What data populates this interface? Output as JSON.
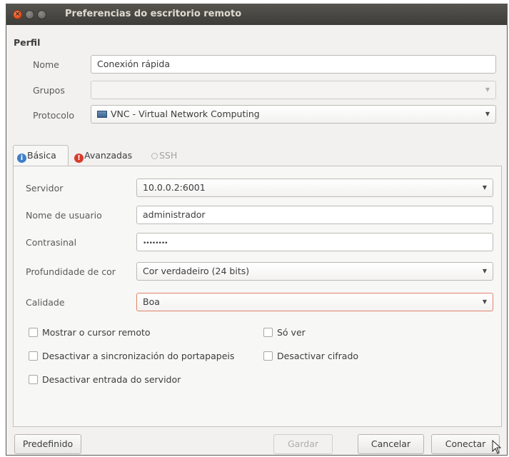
{
  "window": {
    "title": "Preferencias do escritorio remoto"
  },
  "profile": {
    "section_label": "Perfil",
    "name_label": "Nome",
    "name_value": "Conexión rápida",
    "groups_label": "Grupos",
    "groups_value": "",
    "protocol_label": "Protocolo",
    "protocol_value": "VNC - Virtual Network Computing"
  },
  "tabs": [
    {
      "label": "Básica",
      "icon": "info-icon",
      "active": true
    },
    {
      "label": "Avanzadas",
      "icon": "warning-icon",
      "active": false
    },
    {
      "label": "SSH",
      "icon": "ssh-icon",
      "active": false
    }
  ],
  "basic": {
    "server_label": "Servidor",
    "server_value": "10.0.0.2:6001",
    "user_label": "Nome de usuario",
    "user_value": "administrador",
    "password_label": "Contrasinal",
    "password_value": "••••••••",
    "color_depth_label": "Profundidade de cor",
    "color_depth_value": "Cor verdadeiro (24 bits)",
    "quality_label": "Calidade",
    "quality_value": "Boa"
  },
  "checkboxes": {
    "show_remote_cursor": {
      "label": "Mostrar o cursor remoto",
      "checked": false
    },
    "view_only": {
      "label": "Só ver",
      "checked": false
    },
    "disable_clipboard_sync": {
      "label": "Desactivar a sincronización do portapapeis",
      "checked": false
    },
    "disable_encryption": {
      "label": "Desactivar cifrado",
      "checked": false
    },
    "disable_server_input": {
      "label": "Desactivar entrada do servidor",
      "checked": false
    }
  },
  "buttons": {
    "default": "Predefinido",
    "save": "Gardar",
    "cancel": "Cancelar",
    "connect": "Conectar"
  },
  "colors": {
    "titlebar": "#3d3c38",
    "window_bg": "#f2f1f0",
    "focus_border": "#e1836a",
    "info_icon": "#3d7fc9",
    "warning_icon": "#d73c2c"
  }
}
